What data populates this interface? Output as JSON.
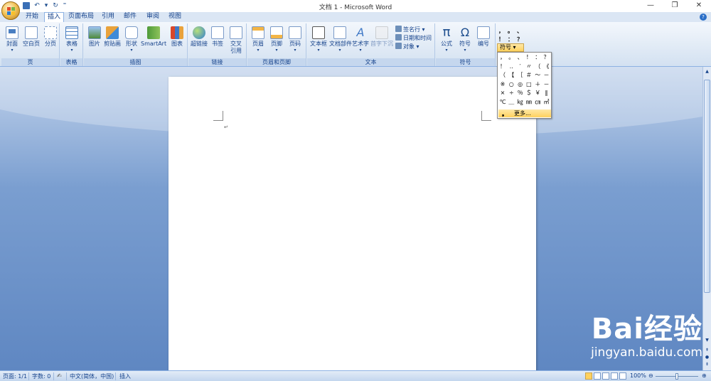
{
  "app": {
    "title": "文档 1 - Microsoft Word",
    "window_buttons": {
      "minimize": "—",
      "restore": "❐",
      "close": "✕"
    }
  },
  "qat": {
    "save": "💾",
    "undo": "↶",
    "undo_dd": "▾",
    "redo": "↻",
    "customize": "⁼"
  },
  "tabs": [
    {
      "label": "开始",
      "active": false
    },
    {
      "label": "插入",
      "active": true
    },
    {
      "label": "页面布局",
      "active": false
    },
    {
      "label": "引用",
      "active": false
    },
    {
      "label": "邮件",
      "active": false
    },
    {
      "label": "审阅",
      "active": false
    },
    {
      "label": "视图",
      "active": false
    }
  ],
  "help": "?",
  "ribbon": {
    "groups": {
      "pages": "页",
      "tables": "表格",
      "illustrations": "插图",
      "links": "链接",
      "header_footer": "页眉和页脚",
      "text": "文本",
      "symbols": "符号"
    },
    "buttons": {
      "cover": "封面",
      "blank_page": "空白页",
      "page_break": "分页",
      "table": "表格",
      "picture": "图片",
      "clipart": "剪贴画",
      "shapes": "形状",
      "smartart": "SmartArt",
      "chart": "图表",
      "hyperlink": "超链接",
      "bookmark": "书签",
      "cross_ref_1": "交叉",
      "cross_ref_2": "引用",
      "header": "页眉",
      "footer": "页脚",
      "page_number": "页码",
      "text_box": "文本框",
      "quick_parts": "文档部件",
      "wordart": "艺术字",
      "drop_cap": "首字下沉",
      "signature_line": "签名行",
      "date_time": "日期和时间",
      "object": "对象",
      "equation": "公式",
      "symbol": "符号",
      "number": "编号"
    },
    "symbol_button": "符号",
    "mini_symbols": [
      "，",
      "。",
      "、",
      "！",
      "：",
      "？"
    ]
  },
  "symbol_dropdown": {
    "rows": [
      [
        "，",
        "。",
        "、",
        "！",
        "：",
        "？"
      ],
      [
        "！",
        "‥",
        "′",
        "〃",
        "（",
        "《"
      ],
      [
        "（",
        "【",
        "［",
        "＃",
        "～",
        "－"
      ],
      [
        "※",
        "○",
        "◎",
        "□",
        "＋",
        "－"
      ],
      [
        "×",
        "÷",
        "％",
        "＄",
        "￥",
        "‖"
      ],
      [
        "℃",
        "＿",
        "㎏",
        "㎜",
        "㎝",
        "㎡"
      ]
    ],
    "more_label": "更多..."
  },
  "document": {
    "para_mark": "↵"
  },
  "status": {
    "page": "页面: 1/1",
    "words": "字数: 0",
    "language": "中文(简体，中国)",
    "mode": "插入",
    "zoom": "100%"
  },
  "watermark": {
    "brand": "Bai经验",
    "url": "jingyan.baidu.com"
  },
  "colors": {
    "ribbon_bg": "#dbe6f4",
    "accent": "#15428b",
    "highlight": "#ffd15d",
    "doc_bg": "#5b83bd"
  }
}
